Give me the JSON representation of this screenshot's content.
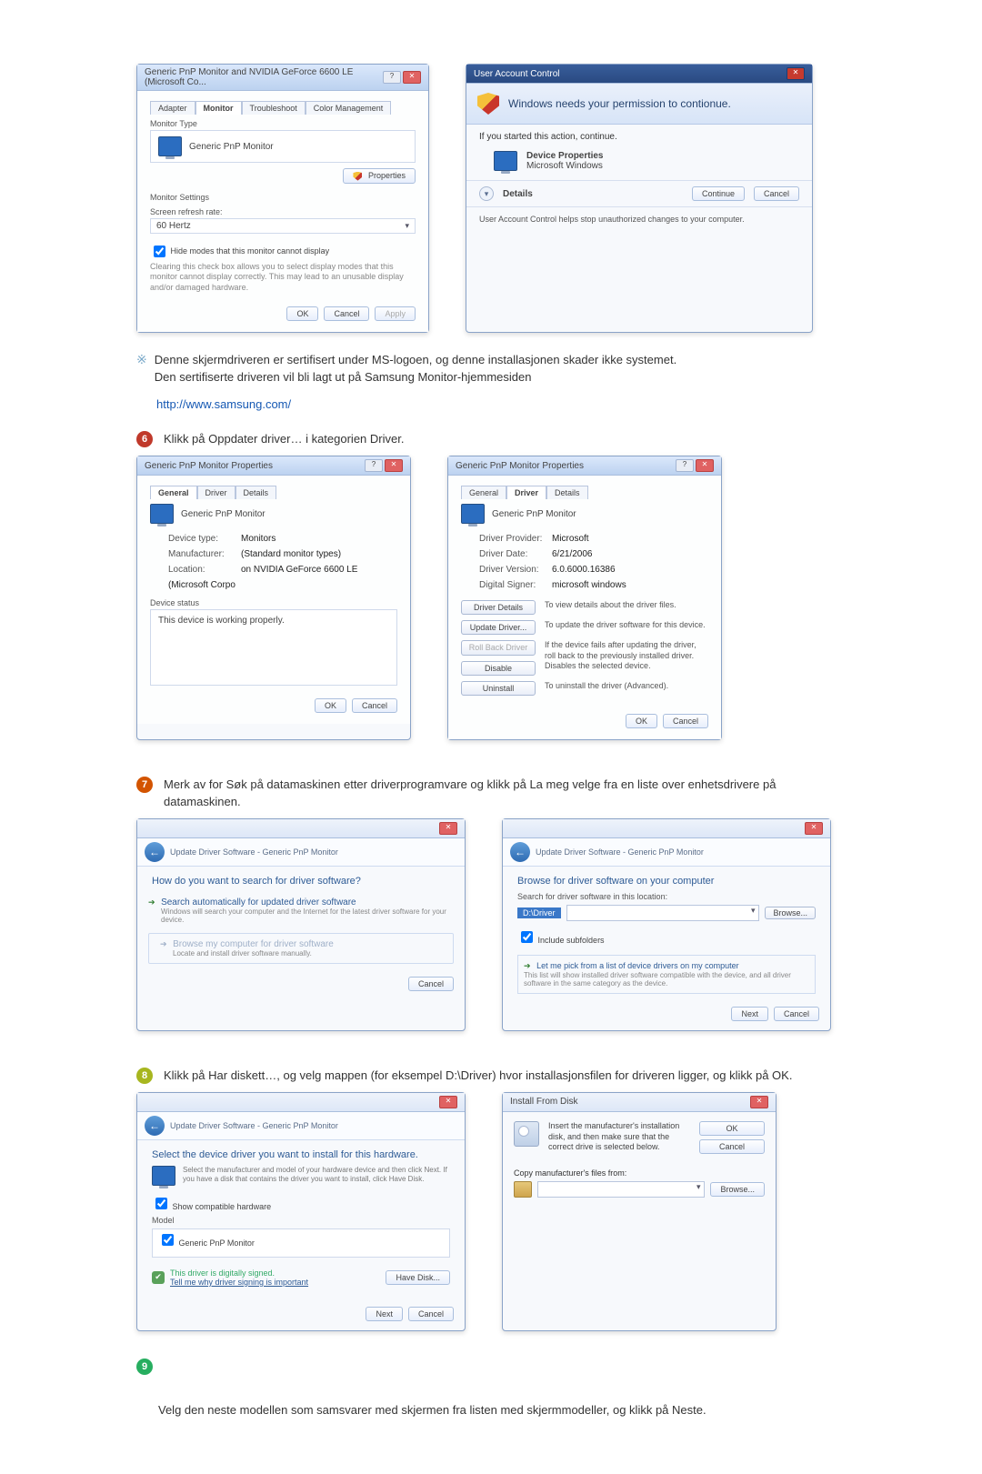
{
  "monitor_dlg": {
    "title": "Generic PnP Monitor and NVIDIA GeForce 6600 LE (Microsoft Co...",
    "tabs": [
      "Adapter",
      "Monitor",
      "Troubleshoot",
      "Color Management"
    ],
    "section_type": "Monitor Type",
    "type_value": "Generic PnP Monitor",
    "properties_btn": "Properties",
    "section_settings": "Monitor Settings",
    "refresh_label": "Screen refresh rate:",
    "refresh_value": "60 Hertz",
    "hide_modes": "Hide modes that this monitor cannot display",
    "hide_desc": "Clearing this check box allows you to select display modes that this monitor cannot display correctly. This may lead to an unusable display and/or damaged hardware.",
    "ok": "OK",
    "cancel": "Cancel",
    "apply": "Apply"
  },
  "uac": {
    "title": "User Account Control",
    "headline": "Windows needs your permission to contionue.",
    "started": "If you started this action, continue.",
    "devprops": "Device Properties",
    "mswin": "Microsoft Windows",
    "details": "Details",
    "continue": "Continue",
    "cancel": "Cancel",
    "foot": "User Account Control helps stop unauthorized changes to your computer."
  },
  "note": {
    "line1": "Denne skjermdriveren er sertifisert under MS-logoen, og denne installasjonen skader ikke systemet.",
    "line2": "Den sertifiserte driveren vil bli lagt ut på Samsung Monitor-hjemmesiden",
    "url": "http://www.samsung.com/"
  },
  "step6": {
    "text": "Klikk på Oppdater driver… i kategorien Driver."
  },
  "props_general": {
    "title": "Generic PnP Monitor Properties",
    "tabs": [
      "General",
      "Driver",
      "Details"
    ],
    "name": "Generic PnP Monitor",
    "k_devtype": "Device type:",
    "v_devtype": "Monitors",
    "k_manu": "Manufacturer:",
    "v_manu": "(Standard monitor types)",
    "k_loc": "Location:",
    "v_loc": "on NVIDIA GeForce 6600 LE (Microsoft Corpo",
    "devstatus": "Device status",
    "working": "This device is working properly.",
    "ok": "OK",
    "cancel": "Cancel"
  },
  "props_driver": {
    "title": "Generic PnP Monitor Properties",
    "tabs": [
      "General",
      "Driver",
      "Details"
    ],
    "name": "Generic PnP Monitor",
    "k_prov": "Driver Provider:",
    "v_prov": "Microsoft",
    "k_date": "Driver Date:",
    "v_date": "6/21/2006",
    "k_ver": "Driver Version:",
    "v_ver": "6.0.6000.16386",
    "k_sign": "Digital Signer:",
    "v_sign": "microsoft windows",
    "btn_details": "Driver Details",
    "d_details": "To view details about the driver files.",
    "btn_update": "Update Driver...",
    "d_update": "To update the driver software for this device.",
    "btn_roll": "Roll Back Driver",
    "d_roll": "If the device fails after updating the driver, roll back to the previously installed driver.",
    "btn_disable": "Disable",
    "d_disable": "Disables the selected device.",
    "btn_uninst": "Uninstall",
    "d_uninst": "To uninstall the driver (Advanced).",
    "ok": "OK",
    "cancel": "Cancel"
  },
  "step7": {
    "text": "Merk av for Søk på datamaskinen etter driverprogramvare og klikk på La meg velge fra en liste over enhetsdrivere på datamaskinen."
  },
  "wiz1": {
    "crumb": "Update Driver Software - Generic PnP Monitor",
    "q": "How do you want to search for driver software?",
    "opt1": "Search automatically for updated driver software",
    "opt1s": "Windows will search your computer and the Internet for the latest driver software for your device.",
    "opt2": "Browse my computer for driver software",
    "opt2s": "Locate and install driver software manually.",
    "cancel": "Cancel"
  },
  "wiz2": {
    "crumb": "Update Driver Software - Generic PnP Monitor",
    "q": "Browse for driver software on your computer",
    "loclabel": "Search for driver software in this location:",
    "path": "D:\\Driver",
    "browse": "Browse...",
    "incsub": "Include subfolders",
    "pick": "Let me pick from a list of device drivers on my computer",
    "picks": "This list will show installed driver software compatible with the device, and all driver software in the same category as the device.",
    "next": "Next",
    "cancel": "Cancel"
  },
  "step8": {
    "text": "Klikk på Har diskett…, og velg mappen (for eksempel D:\\Driver) hvor installasjonsfilen for driveren ligger, og klikk på OK."
  },
  "hw": {
    "crumb": "Update Driver Software - Generic PnP Monitor",
    "head": "Select the device driver you want to install for this hardware.",
    "sub": "Select the manufacturer and model of your hardware device and then click Next. If you have a disk that contains the driver you want to install, click Have Disk.",
    "show": "Show compatible hardware",
    "model_h": "Model",
    "model": "Generic PnP Monitor",
    "signed": "This driver is digitally signed.",
    "tell": "Tell me why driver signing is important",
    "havedisk": "Have Disk...",
    "next": "Next",
    "cancel": "Cancel"
  },
  "ifd": {
    "title": "Install From Disk",
    "msg": "Insert the manufacturer's installation disk, and then make sure that the correct drive is selected below.",
    "ok": "OK",
    "cancel": "Cancel",
    "copy": "Copy manufacturer's files from:",
    "browse": "Browse..."
  },
  "step9": {
    "text": "Velg den neste modellen som samsvarer med skjermen fra listen med skjermmodeller, og klikk på Neste."
  }
}
